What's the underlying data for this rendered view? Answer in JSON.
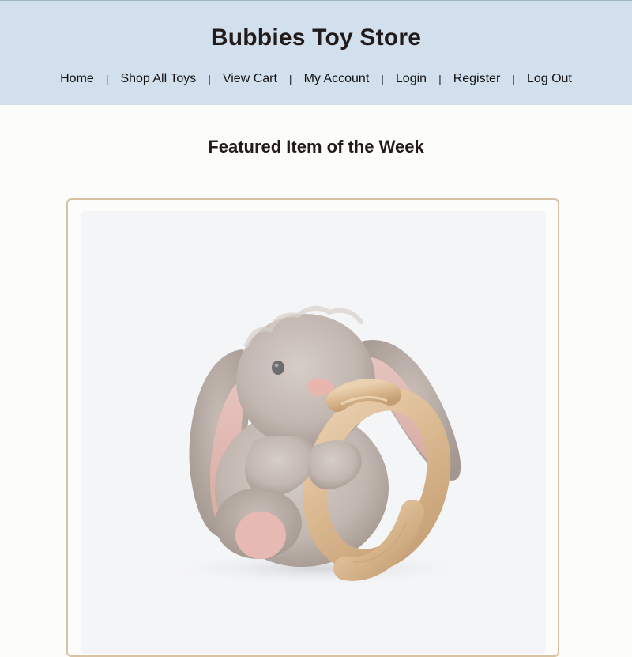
{
  "header": {
    "title": "Bubbies Toy Store",
    "nav": [
      {
        "label": "Home"
      },
      {
        "label": "Shop All Toys"
      },
      {
        "label": "View Cart"
      },
      {
        "label": "My Account"
      },
      {
        "label": "Login"
      },
      {
        "label": "Register"
      },
      {
        "label": "Log Out"
      }
    ],
    "separator": "|"
  },
  "main": {
    "featured_heading": "Featured Item of the Week",
    "featured_image": {
      "icon": "plush-bunny-with-wooden-ring-image"
    }
  },
  "colors": {
    "header_bg": "#d1e0ec",
    "page_bg": "#fcfcfb",
    "card_border": "#d9c2a2",
    "text": "#231b1b"
  }
}
